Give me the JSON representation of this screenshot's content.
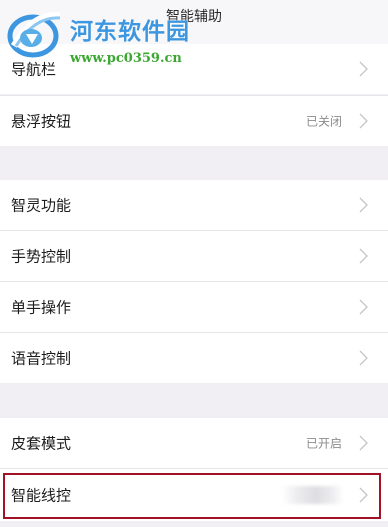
{
  "header": {
    "title": "智能辅助"
  },
  "watermark": {
    "title": "河东软件园",
    "url": "www.pc0359.cn"
  },
  "section1": {
    "items": [
      {
        "label": "导航栏",
        "value": ""
      },
      {
        "label": "悬浮按钮",
        "value": "已关闭"
      }
    ]
  },
  "section2": {
    "items": [
      {
        "label": "智灵功能",
        "value": ""
      },
      {
        "label": "手势控制",
        "value": ""
      },
      {
        "label": "单手操作",
        "value": ""
      },
      {
        "label": "语音控制",
        "value": ""
      }
    ]
  },
  "section3": {
    "items": [
      {
        "label": "皮套模式",
        "value": "已开启"
      },
      {
        "label": "智能线控",
        "value": ""
      }
    ]
  },
  "icons": {
    "row_arrow": "chevron-right-icon",
    "watermark_logo": "pc0359-logo-icon"
  },
  "colors": {
    "background": "#f1eff3",
    "row": "#ffffff",
    "highlight": "#a01426",
    "watermark_blue": "#3d97e0",
    "watermark_green": "#3ca832"
  }
}
